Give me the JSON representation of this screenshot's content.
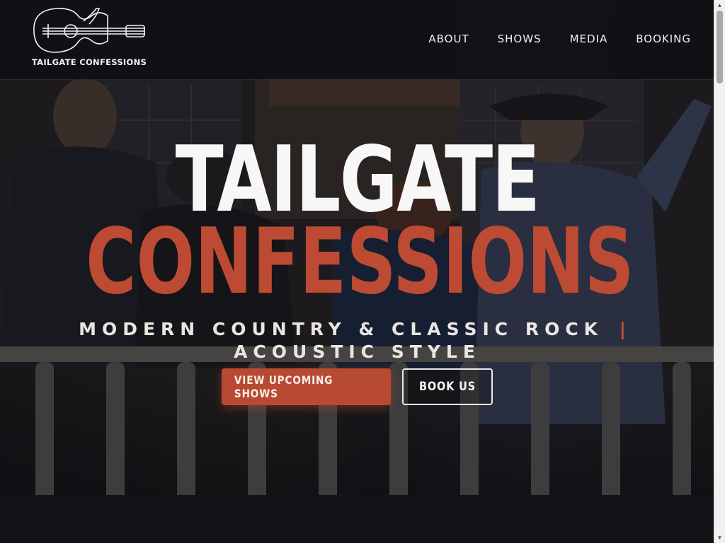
{
  "header": {
    "logo_text": "TAILGATE CONFESSIONS",
    "nav": {
      "about": "ABOUT",
      "shows": "SHOWS",
      "media": "MEDIA",
      "booking": "BOOKING"
    }
  },
  "hero": {
    "title_line1": "TAILGATE",
    "title_line2": "CONFESSIONS",
    "tagline_left": "MODERN COUNTRY & CLASSIC ROCK",
    "tagline_separator": "|",
    "tagline_right": "ACOUSTIC STYLE",
    "primary_button": "VIEW UPCOMING SHOWS",
    "secondary_button": "BOOK US"
  },
  "colors": {
    "accent": "#b84a33",
    "title_white": "#f7f7f7",
    "header_bg": "#101014"
  },
  "icons": {
    "logo": "guitar-logo-icon",
    "scroll_up": "scroll-up-arrow-icon",
    "scroll_down": "scroll-down-arrow-icon"
  }
}
